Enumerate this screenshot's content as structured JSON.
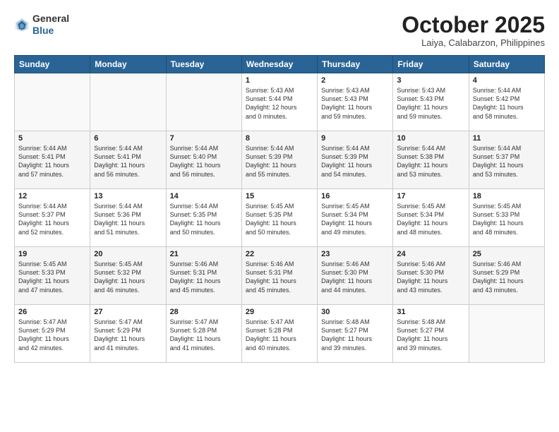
{
  "header": {
    "logo": {
      "general": "General",
      "blue": "Blue"
    },
    "title": "October 2025",
    "subtitle": "Laiya, Calabarzon, Philippines"
  },
  "weekdays": [
    "Sunday",
    "Monday",
    "Tuesday",
    "Wednesday",
    "Thursday",
    "Friday",
    "Saturday"
  ],
  "weeks": [
    [
      {
        "day": "",
        "info": ""
      },
      {
        "day": "",
        "info": ""
      },
      {
        "day": "",
        "info": ""
      },
      {
        "day": "1",
        "info": "Sunrise: 5:43 AM\nSunset: 5:44 PM\nDaylight: 12 hours\nand 0 minutes."
      },
      {
        "day": "2",
        "info": "Sunrise: 5:43 AM\nSunset: 5:43 PM\nDaylight: 11 hours\nand 59 minutes."
      },
      {
        "day": "3",
        "info": "Sunrise: 5:43 AM\nSunset: 5:43 PM\nDaylight: 11 hours\nand 59 minutes."
      },
      {
        "day": "4",
        "info": "Sunrise: 5:44 AM\nSunset: 5:42 PM\nDaylight: 11 hours\nand 58 minutes."
      }
    ],
    [
      {
        "day": "5",
        "info": "Sunrise: 5:44 AM\nSunset: 5:41 PM\nDaylight: 11 hours\nand 57 minutes."
      },
      {
        "day": "6",
        "info": "Sunrise: 5:44 AM\nSunset: 5:41 PM\nDaylight: 11 hours\nand 56 minutes."
      },
      {
        "day": "7",
        "info": "Sunrise: 5:44 AM\nSunset: 5:40 PM\nDaylight: 11 hours\nand 56 minutes."
      },
      {
        "day": "8",
        "info": "Sunrise: 5:44 AM\nSunset: 5:39 PM\nDaylight: 11 hours\nand 55 minutes."
      },
      {
        "day": "9",
        "info": "Sunrise: 5:44 AM\nSunset: 5:39 PM\nDaylight: 11 hours\nand 54 minutes."
      },
      {
        "day": "10",
        "info": "Sunrise: 5:44 AM\nSunset: 5:38 PM\nDaylight: 11 hours\nand 53 minutes."
      },
      {
        "day": "11",
        "info": "Sunrise: 5:44 AM\nSunset: 5:37 PM\nDaylight: 11 hours\nand 53 minutes."
      }
    ],
    [
      {
        "day": "12",
        "info": "Sunrise: 5:44 AM\nSunset: 5:37 PM\nDaylight: 11 hours\nand 52 minutes."
      },
      {
        "day": "13",
        "info": "Sunrise: 5:44 AM\nSunset: 5:36 PM\nDaylight: 11 hours\nand 51 minutes."
      },
      {
        "day": "14",
        "info": "Sunrise: 5:44 AM\nSunset: 5:35 PM\nDaylight: 11 hours\nand 50 minutes."
      },
      {
        "day": "15",
        "info": "Sunrise: 5:45 AM\nSunset: 5:35 PM\nDaylight: 11 hours\nand 50 minutes."
      },
      {
        "day": "16",
        "info": "Sunrise: 5:45 AM\nSunset: 5:34 PM\nDaylight: 11 hours\nand 49 minutes."
      },
      {
        "day": "17",
        "info": "Sunrise: 5:45 AM\nSunset: 5:34 PM\nDaylight: 11 hours\nand 48 minutes."
      },
      {
        "day": "18",
        "info": "Sunrise: 5:45 AM\nSunset: 5:33 PM\nDaylight: 11 hours\nand 48 minutes."
      }
    ],
    [
      {
        "day": "19",
        "info": "Sunrise: 5:45 AM\nSunset: 5:33 PM\nDaylight: 11 hours\nand 47 minutes."
      },
      {
        "day": "20",
        "info": "Sunrise: 5:45 AM\nSunset: 5:32 PM\nDaylight: 11 hours\nand 46 minutes."
      },
      {
        "day": "21",
        "info": "Sunrise: 5:46 AM\nSunset: 5:31 PM\nDaylight: 11 hours\nand 45 minutes."
      },
      {
        "day": "22",
        "info": "Sunrise: 5:46 AM\nSunset: 5:31 PM\nDaylight: 11 hours\nand 45 minutes."
      },
      {
        "day": "23",
        "info": "Sunrise: 5:46 AM\nSunset: 5:30 PM\nDaylight: 11 hours\nand 44 minutes."
      },
      {
        "day": "24",
        "info": "Sunrise: 5:46 AM\nSunset: 5:30 PM\nDaylight: 11 hours\nand 43 minutes."
      },
      {
        "day": "25",
        "info": "Sunrise: 5:46 AM\nSunset: 5:29 PM\nDaylight: 11 hours\nand 43 minutes."
      }
    ],
    [
      {
        "day": "26",
        "info": "Sunrise: 5:47 AM\nSunset: 5:29 PM\nDaylight: 11 hours\nand 42 minutes."
      },
      {
        "day": "27",
        "info": "Sunrise: 5:47 AM\nSunset: 5:29 PM\nDaylight: 11 hours\nand 41 minutes."
      },
      {
        "day": "28",
        "info": "Sunrise: 5:47 AM\nSunset: 5:28 PM\nDaylight: 11 hours\nand 41 minutes."
      },
      {
        "day": "29",
        "info": "Sunrise: 5:47 AM\nSunset: 5:28 PM\nDaylight: 11 hours\nand 40 minutes."
      },
      {
        "day": "30",
        "info": "Sunrise: 5:48 AM\nSunset: 5:27 PM\nDaylight: 11 hours\nand 39 minutes."
      },
      {
        "day": "31",
        "info": "Sunrise: 5:48 AM\nSunset: 5:27 PM\nDaylight: 11 hours\nand 39 minutes."
      },
      {
        "day": "",
        "info": ""
      }
    ]
  ]
}
